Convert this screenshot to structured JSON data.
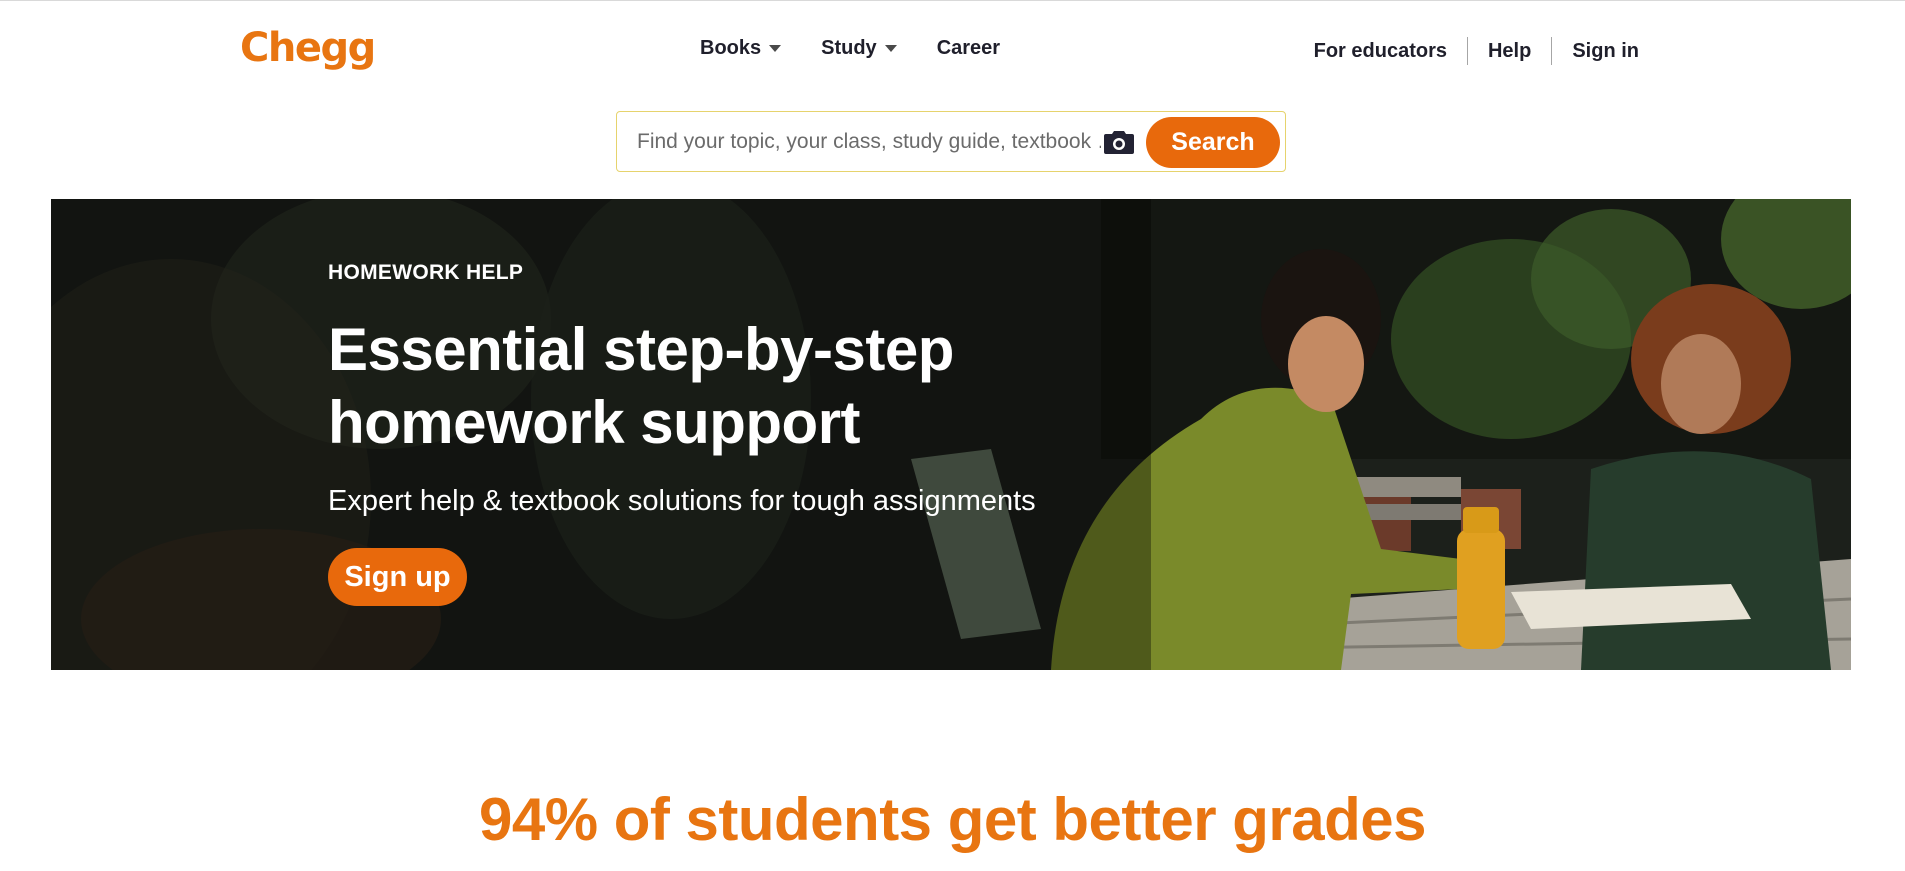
{
  "header": {
    "logo": "Chegg",
    "nav": [
      {
        "label": "Books",
        "has_dropdown": true
      },
      {
        "label": "Study",
        "has_dropdown": true
      },
      {
        "label": "Career",
        "has_dropdown": false
      }
    ],
    "right_links": [
      "For educators",
      "Help",
      "Sign in"
    ]
  },
  "search": {
    "placeholder": "Find your topic, your class, study guide, textbook …",
    "camera_icon": "camera-icon",
    "button_label": "Search"
  },
  "hero": {
    "eyebrow": "HOMEWORK HELP",
    "title_line1": "Essential step-by-step",
    "title_line2": "homework support",
    "subtitle": "Expert help & textbook solutions for tough assignments",
    "cta_label": "Sign up"
  },
  "stats": {
    "heading_line1": "94% of students get better grades"
  },
  "colors": {
    "brand_orange": "#e87511",
    "button_orange": "#e8690c",
    "text_dark": "#1f1f2b",
    "search_border": "#e6d36d"
  }
}
